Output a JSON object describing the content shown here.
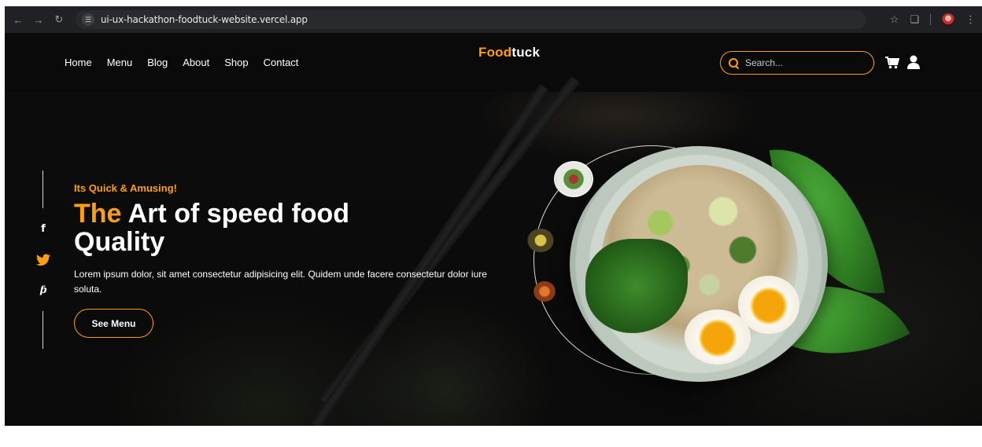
{
  "browser": {
    "url": "ui-ux-hackathon-foodtuck-website.vercel.app",
    "back_icon": "arrow-left-icon",
    "forward_icon": "arrow-right-icon",
    "reload_icon": "reload-icon"
  },
  "header": {
    "logo_part1": "Food",
    "logo_part2": "tuck",
    "nav": [
      "Home",
      "Menu",
      "Blog",
      "About",
      "Shop",
      "Contact"
    ],
    "search_placeholder": "Search..."
  },
  "hero": {
    "tagline": "Its Quick & Amusing!",
    "headline_accent": "The",
    "headline_line1_rest": " Art of speed food",
    "headline_line2": "Quality",
    "description": "Lorem ipsum dolor, sit amet consectetur adipisicing elit. Quidem unde facere consectetur dolor iure soluta.",
    "cta_label": "See Menu"
  },
  "social": {
    "facebook": "f",
    "pinterest": "ƥ"
  },
  "colors": {
    "accent": "#ff9f0d",
    "background": "#0a0a0a",
    "text": "#ffffff"
  }
}
